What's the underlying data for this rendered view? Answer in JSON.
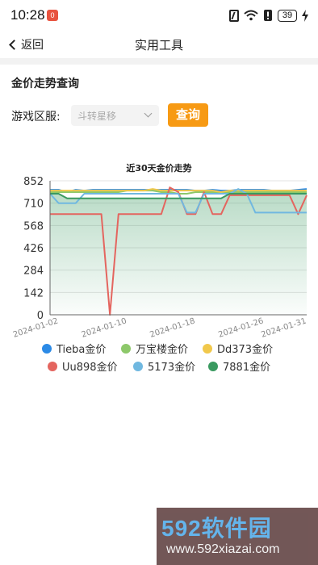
{
  "status_bar": {
    "time": "10:28",
    "notification_badge": "0",
    "battery": "39",
    "icons": [
      "nfc-icon",
      "wifi-icon",
      "alert-icon",
      "battery-icon",
      "charging-icon"
    ]
  },
  "header": {
    "back_label": "返回",
    "title": "实用工具"
  },
  "query": {
    "section_title": "金价走势查询",
    "server_label": "游戏区服:",
    "server_value": "斗转星移",
    "query_button": "查询"
  },
  "chart_data": {
    "type": "line",
    "title": "近30天金价走势",
    "xlabel": "",
    "ylabel": "",
    "ylim": [
      0,
      852
    ],
    "yticks": [
      0,
      142,
      284,
      426,
      568,
      710,
      852
    ],
    "x": [
      "2024-01-01",
      "2024-01-02",
      "2024-01-03",
      "2024-01-04",
      "2024-01-05",
      "2024-01-06",
      "2024-01-07",
      "2024-01-08",
      "2024-01-09",
      "2024-01-10",
      "2024-01-11",
      "2024-01-12",
      "2024-01-13",
      "2024-01-14",
      "2024-01-15",
      "2024-01-16",
      "2024-01-17",
      "2024-01-18",
      "2024-01-19",
      "2024-01-20",
      "2024-01-21",
      "2024-01-22",
      "2024-01-23",
      "2024-01-24",
      "2024-01-25",
      "2024-01-26",
      "2024-01-27",
      "2024-01-28",
      "2024-01-29",
      "2024-01-30",
      "2024-01-31"
    ],
    "xtick_labels": [
      "2024-01-02",
      "2024-01-10",
      "2024-01-18",
      "2024-01-26",
      "2024-01-31"
    ],
    "legend_position": "bottom",
    "grid": true,
    "series": [
      {
        "name": "Tieba金价",
        "color": "#2b8ae6",
        "values": [
          795,
          795,
          780,
          795,
          790,
          795,
          795,
          795,
          795,
          795,
          795,
          795,
          795,
          795,
          795,
          795,
          795,
          790,
          790,
          795,
          790,
          790,
          795,
          795,
          795,
          795,
          790,
          790,
          790,
          795,
          800
        ]
      },
      {
        "name": "万宝楼金价",
        "color": "#8dc86a",
        "values": [
          780,
          780,
          780,
          780,
          780,
          780,
          780,
          780,
          780,
          790,
          790,
          790,
          790,
          780,
          780,
          770,
          770,
          780,
          780,
          780,
          780,
          780,
          780,
          780,
          780,
          780,
          780,
          780,
          780,
          780,
          780
        ]
      },
      {
        "name": "Dd373金价",
        "color": "#f1c84b",
        "values": [
          790,
          790,
          790,
          790,
          790,
          790,
          790,
          790,
          790,
          790,
          790,
          790,
          800,
          790,
          790,
          790,
          790,
          790,
          790,
          790,
          780,
          790,
          790,
          790,
          790,
          790,
          790,
          790,
          790,
          790,
          790
        ]
      },
      {
        "name": "Uu898金价",
        "color": "#e4655f",
        "values": [
          640,
          640,
          640,
          640,
          640,
          640,
          640,
          0,
          640,
          640,
          640,
          640,
          640,
          640,
          810,
          780,
          640,
          640,
          780,
          640,
          640,
          760,
          760,
          760,
          760,
          760,
          760,
          760,
          760,
          640,
          760
        ]
      },
      {
        "name": "5173金价",
        "color": "#70b8e0",
        "values": [
          770,
          710,
          710,
          710,
          770,
          770,
          770,
          770,
          770,
          770,
          770,
          770,
          770,
          770,
          770,
          770,
          650,
          650,
          770,
          770,
          770,
          770,
          800,
          770,
          650,
          650,
          650,
          650,
          650,
          650,
          650
        ]
      },
      {
        "name": "7881金价",
        "color": "#3a9a60",
        "values": [
          770,
          770,
          740,
          740,
          740,
          740,
          740,
          740,
          740,
          740,
          740,
          740,
          740,
          740,
          740,
          740,
          740,
          740,
          740,
          740,
          740,
          770,
          770,
          770,
          770,
          770,
          770,
          770,
          770,
          770,
          770
        ]
      }
    ]
  },
  "watermark": {
    "brand": "592软件园",
    "url": "www.592xiazai.com"
  }
}
